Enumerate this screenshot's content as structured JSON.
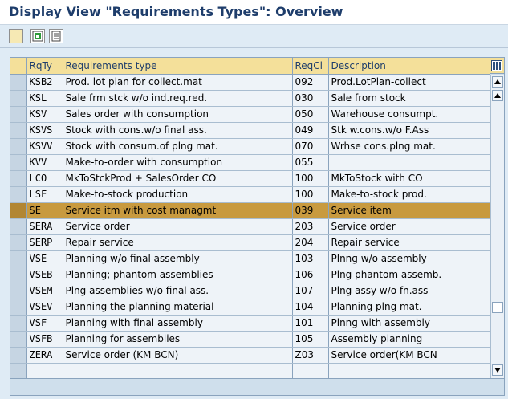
{
  "window": {
    "title": "Display View \"Requirements Types\": Overview"
  },
  "toolbar": {
    "buttons": [
      {
        "icon": "blank-document-icon"
      },
      {
        "icon": "select-all-icon"
      },
      {
        "icon": "print-list-icon"
      }
    ]
  },
  "table": {
    "columns": {
      "key": "RqTy",
      "type": "Requirements type",
      "reqcl": "ReqCl",
      "desc": "Description"
    },
    "rows": [
      {
        "key": "KSB2",
        "type": "Prod. lot plan for collect.mat",
        "reqcl": "092",
        "desc": "Prod.LotPlan-collect"
      },
      {
        "key": "KSL",
        "type": "Sale frm stck w/o ind.req.red.",
        "reqcl": "030",
        "desc": "Sale from stock"
      },
      {
        "key": "KSV",
        "type": "Sales order with consumption",
        "reqcl": "050",
        "desc": "Warehouse consumpt."
      },
      {
        "key": "KSVS",
        "type": "Stock with cons.w/o final ass.",
        "reqcl": "049",
        "desc": "Stk w.cons.w/o F.Ass"
      },
      {
        "key": "KSVV",
        "type": "Stock with consum.of plng mat.",
        "reqcl": "070",
        "desc": "Wrhse cons.plng mat."
      },
      {
        "key": "KVV",
        "type": "Make-to-order with consumption",
        "reqcl": "055",
        "desc": ""
      },
      {
        "key": "LCO",
        "type": "MkToStckProd + SalesOrder CO",
        "reqcl": "100",
        "desc": "MkToStock with CO"
      },
      {
        "key": "LSF",
        "type": "Make-to-stock production",
        "reqcl": "100",
        "desc": "Make-to-stock prod."
      },
      {
        "key": "SE",
        "type": "Service itm with cost managmt",
        "reqcl": "039",
        "desc": "Service item"
      },
      {
        "key": "SERA",
        "type": "Service order",
        "reqcl": "203",
        "desc": "Service order"
      },
      {
        "key": "SERP",
        "type": "Repair service",
        "reqcl": "204",
        "desc": "Repair service"
      },
      {
        "key": "VSE",
        "type": "Planning w/o final assembly",
        "reqcl": "103",
        "desc": "Plnng w/o assembly"
      },
      {
        "key": "VSEB",
        "type": "Planning; phantom assemblies",
        "reqcl": "106",
        "desc": "Plng phantom assemb."
      },
      {
        "key": "VSEM",
        "type": "Plng assemblies w/o final ass.",
        "reqcl": "107",
        "desc": "Plng assy w/o fn.ass"
      },
      {
        "key": "VSEV",
        "type": "Planning the planning material",
        "reqcl": "104",
        "desc": "Planning plng mat."
      },
      {
        "key": "VSF",
        "type": "Planning with final assembly",
        "reqcl": "101",
        "desc": "Plnng with assembly"
      },
      {
        "key": "VSFB",
        "type": "Planning for assemblies",
        "reqcl": "105",
        "desc": "Assembly planning"
      },
      {
        "key": "ZERA",
        "type": "Service order (KM BCN)",
        "reqcl": "Z03",
        "desc": "Service order(KM BCN"
      },
      {
        "key": "",
        "type": "",
        "reqcl": "",
        "desc": ""
      }
    ],
    "highlighted_row": 8
  },
  "scrollbar": {
    "position_fraction": 0.8
  },
  "colors": {
    "title_text": "#1e3d6b",
    "header_bg": "#f4e09a",
    "highlight": "#c89a3f",
    "background": "#dfebf5"
  }
}
